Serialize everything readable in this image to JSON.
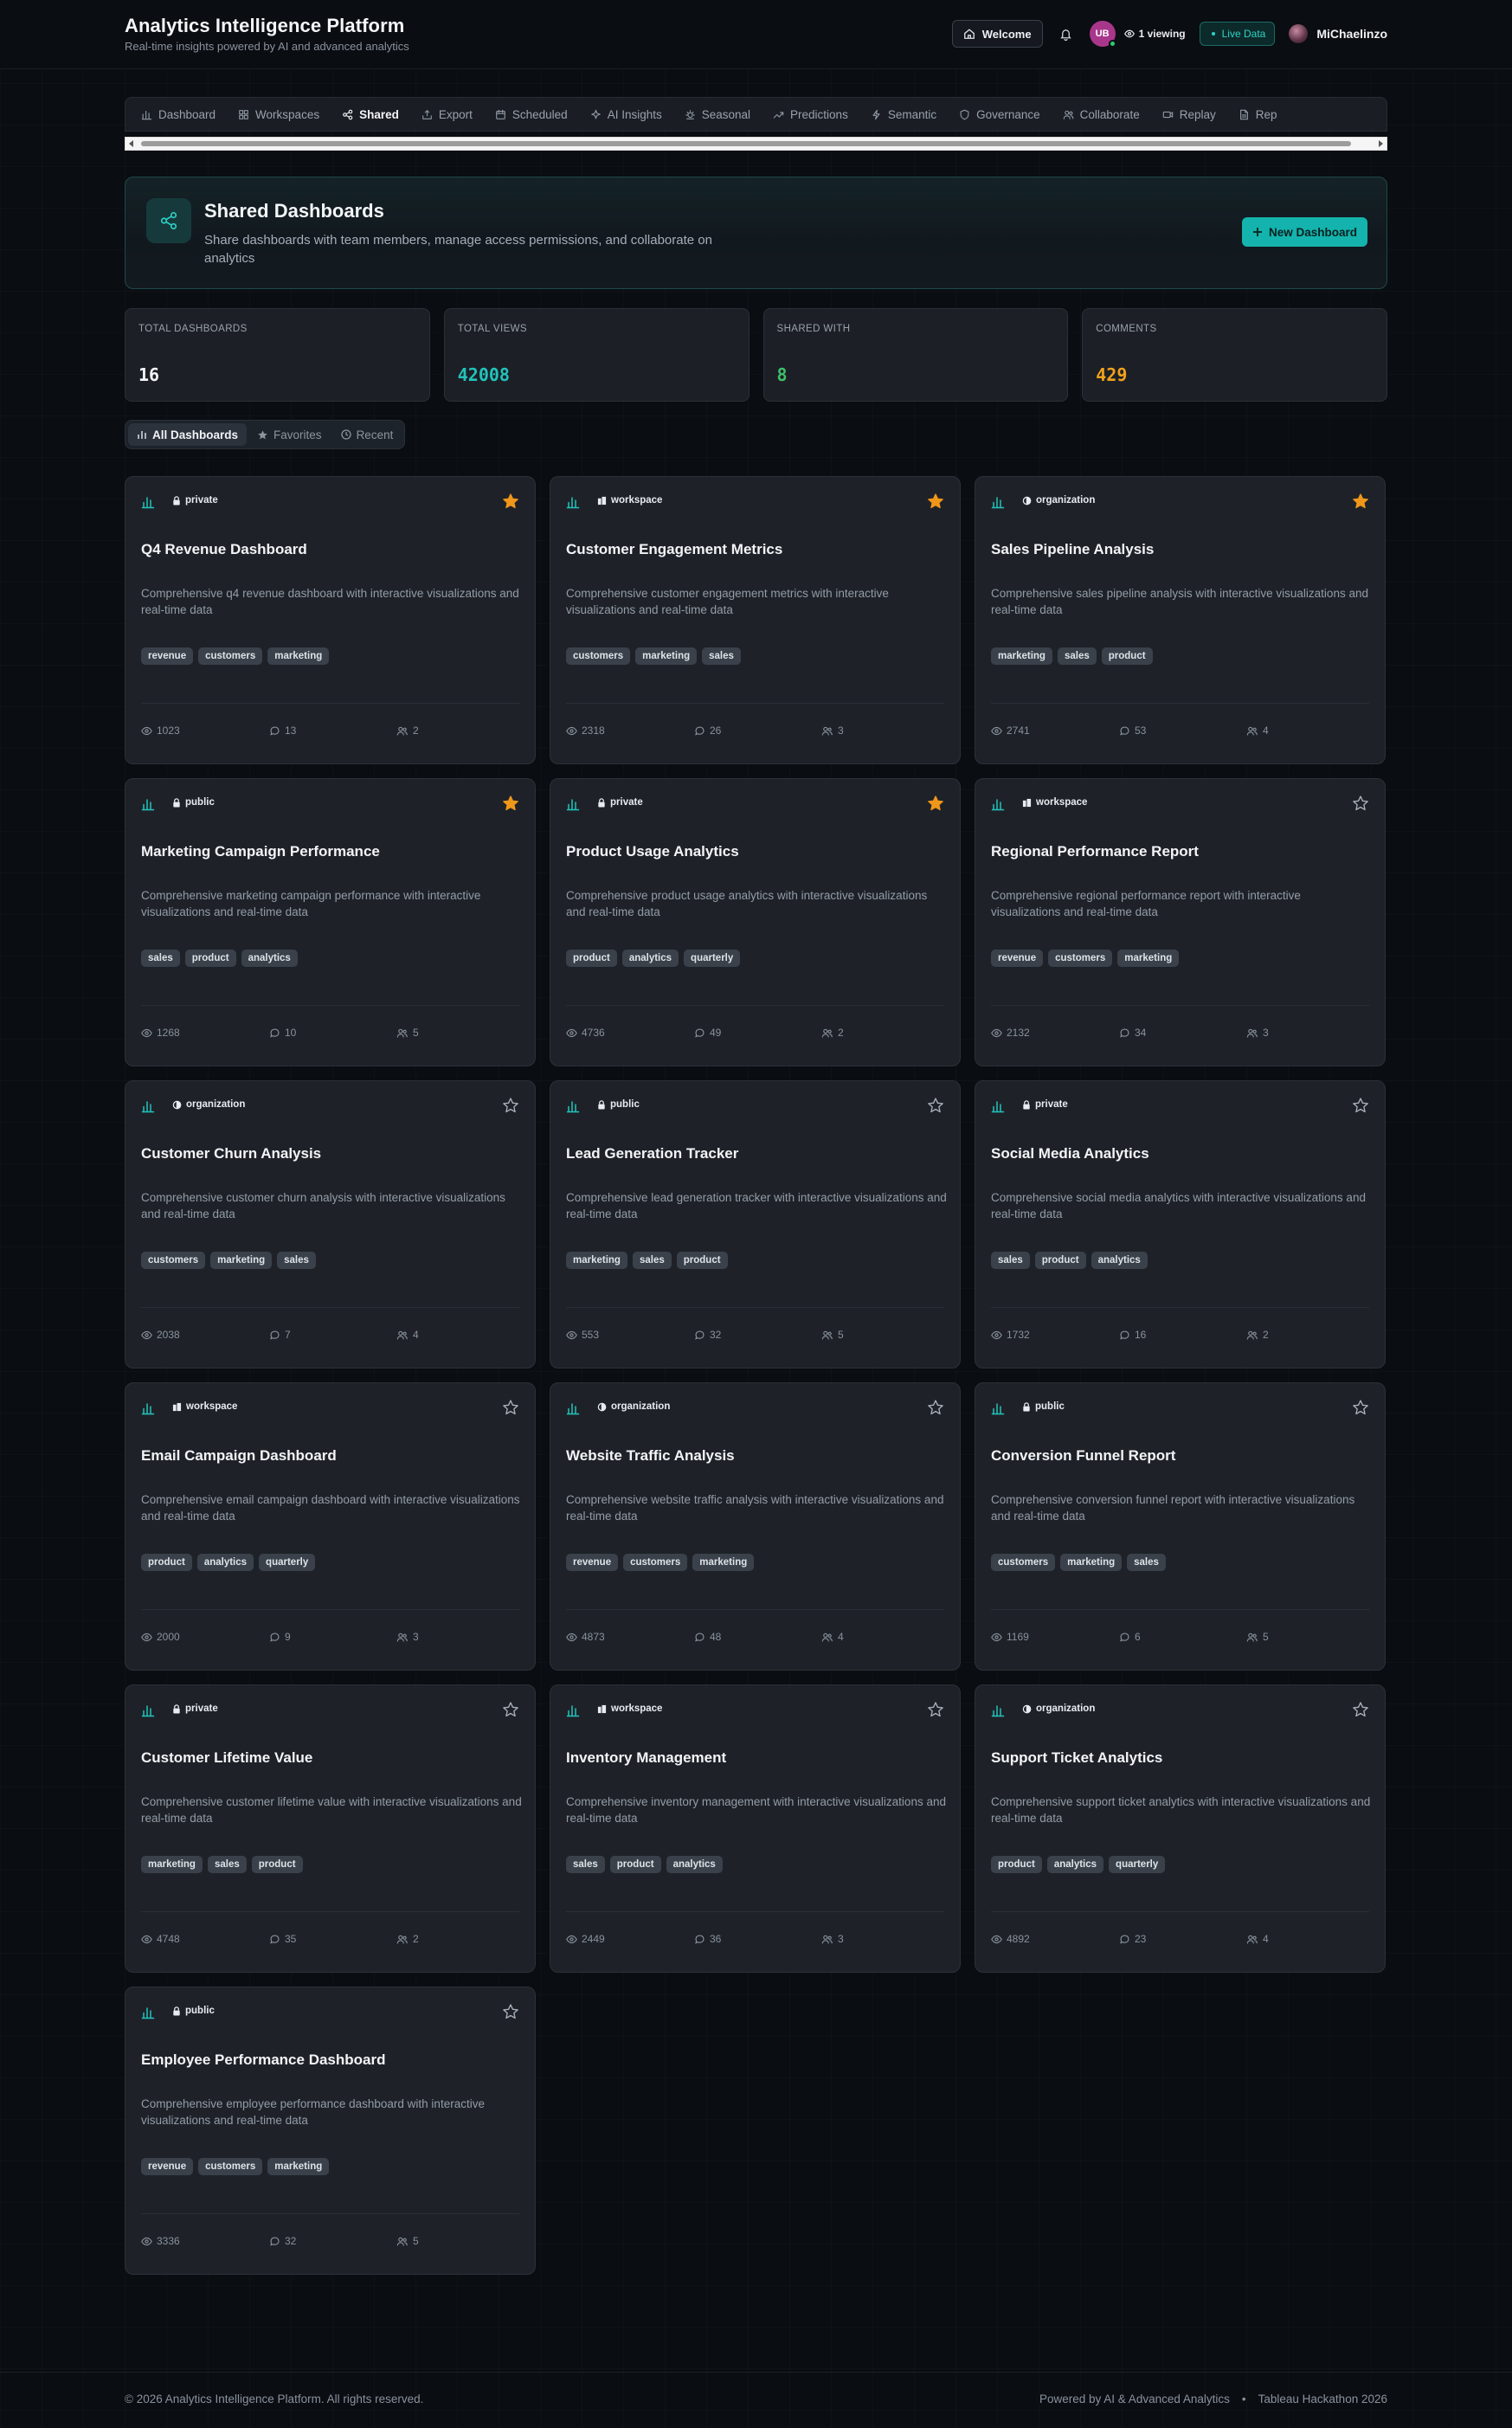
{
  "header": {
    "title": "Analytics Intelligence Platform",
    "subtitle": "Real-time insights powered by AI and advanced analytics",
    "welcome_label": "Welcome",
    "avatar_initials": "UB",
    "viewing": "1 viewing",
    "live_label": "Live Data",
    "username": "MiChaelinzo"
  },
  "nav": {
    "tabs": [
      {
        "label": "Dashboard",
        "icon": "bar-chart-icon",
        "active": false
      },
      {
        "label": "Workspaces",
        "icon": "grid-icon",
        "active": false
      },
      {
        "label": "Shared",
        "icon": "share-icon",
        "active": true
      },
      {
        "label": "Export",
        "icon": "export-icon",
        "active": false
      },
      {
        "label": "Scheduled",
        "icon": "calendar-icon",
        "active": false
      },
      {
        "label": "AI Insights",
        "icon": "sparkle-icon",
        "active": false
      },
      {
        "label": "Seasonal",
        "icon": "seasonal-icon",
        "active": false
      },
      {
        "label": "Predictions",
        "icon": "trend-icon",
        "active": false
      },
      {
        "label": "Semantic",
        "icon": "lightning-icon",
        "active": false
      },
      {
        "label": "Governance",
        "icon": "shield-icon",
        "active": false
      },
      {
        "label": "Collaborate",
        "icon": "users-icon",
        "active": false
      },
      {
        "label": "Replay",
        "icon": "video-icon",
        "active": false
      },
      {
        "label": "Rep",
        "icon": "file-icon",
        "active": false
      }
    ]
  },
  "hero": {
    "title": "Shared Dashboards",
    "description": "Share dashboards with team members, manage access permissions, and collaborate on analytics",
    "new_button": "New Dashboard"
  },
  "stats": [
    {
      "label": "TOTAL DASHBOARDS",
      "value": "16",
      "color": "#f2f4f7"
    },
    {
      "label": "TOTAL VIEWS",
      "value": "42008",
      "color": "#22c3bb"
    },
    {
      "label": "SHARED WITH",
      "value": "8",
      "color": "#3fbf6a"
    },
    {
      "label": "COMMENTS",
      "value": "429",
      "color": "#f0a21a"
    }
  ],
  "filters": {
    "all": "All Dashboards",
    "favorites": "Favorites",
    "recent": "Recent"
  },
  "colors": {
    "accent": "#14b3ad",
    "star_filled": "#f0961a",
    "background": "#0a0d11",
    "card": "#1e2228"
  },
  "dashboards": [
    {
      "title": "Q4 Revenue Dashboard",
      "visibility": "private",
      "favorite": true,
      "description": "Comprehensive q4 revenue dashboard with interactive visualizations and real-time data",
      "tags": [
        "revenue",
        "customers",
        "marketing"
      ],
      "views": "1023",
      "comments": "13",
      "shared": "2"
    },
    {
      "title": "Customer Engagement Metrics",
      "visibility": "workspace",
      "favorite": true,
      "description": "Comprehensive customer engagement metrics with interactive visualizations and real-time data",
      "tags": [
        "customers",
        "marketing",
        "sales"
      ],
      "views": "2318",
      "comments": "26",
      "shared": "3"
    },
    {
      "title": "Sales Pipeline Analysis",
      "visibility": "organization",
      "favorite": true,
      "description": "Comprehensive sales pipeline analysis with interactive visualizations and real-time data",
      "tags": [
        "marketing",
        "sales",
        "product"
      ],
      "views": "2741",
      "comments": "53",
      "shared": "4"
    },
    {
      "title": "Marketing Campaign Performance",
      "visibility": "public",
      "favorite": true,
      "description": "Comprehensive marketing campaign performance with interactive visualizations and real-time data",
      "tags": [
        "sales",
        "product",
        "analytics"
      ],
      "views": "1268",
      "comments": "10",
      "shared": "5"
    },
    {
      "title": "Product Usage Analytics",
      "visibility": "private",
      "favorite": true,
      "description": "Comprehensive product usage analytics with interactive visualizations and real-time data",
      "tags": [
        "product",
        "analytics",
        "quarterly"
      ],
      "views": "4736",
      "comments": "49",
      "shared": "2"
    },
    {
      "title": "Regional Performance Report",
      "visibility": "workspace",
      "favorite": false,
      "description": "Comprehensive regional performance report with interactive visualizations and real-time data",
      "tags": [
        "revenue",
        "customers",
        "marketing"
      ],
      "views": "2132",
      "comments": "34",
      "shared": "3"
    },
    {
      "title": "Customer Churn Analysis",
      "visibility": "organization",
      "favorite": false,
      "description": "Comprehensive customer churn analysis with interactive visualizations and real-time data",
      "tags": [
        "customers",
        "marketing",
        "sales"
      ],
      "views": "2038",
      "comments": "7",
      "shared": "4"
    },
    {
      "title": "Lead Generation Tracker",
      "visibility": "public",
      "favorite": false,
      "description": "Comprehensive lead generation tracker with interactive visualizations and real-time data",
      "tags": [
        "marketing",
        "sales",
        "product"
      ],
      "views": "553",
      "comments": "32",
      "shared": "5"
    },
    {
      "title": "Social Media Analytics",
      "visibility": "private",
      "favorite": false,
      "description": "Comprehensive social media analytics with interactive visualizations and real-time data",
      "tags": [
        "sales",
        "product",
        "analytics"
      ],
      "views": "1732",
      "comments": "16",
      "shared": "2"
    },
    {
      "title": "Email Campaign Dashboard",
      "visibility": "workspace",
      "favorite": false,
      "description": "Comprehensive email campaign dashboard with interactive visualizations and real-time data",
      "tags": [
        "product",
        "analytics",
        "quarterly"
      ],
      "views": "2000",
      "comments": "9",
      "shared": "3"
    },
    {
      "title": "Website Traffic Analysis",
      "visibility": "organization",
      "favorite": false,
      "description": "Comprehensive website traffic analysis with interactive visualizations and real-time data",
      "tags": [
        "revenue",
        "customers",
        "marketing"
      ],
      "views": "4873",
      "comments": "48",
      "shared": "4"
    },
    {
      "title": "Conversion Funnel Report",
      "visibility": "public",
      "favorite": false,
      "description": "Comprehensive conversion funnel report with interactive visualizations and real-time data",
      "tags": [
        "customers",
        "marketing",
        "sales"
      ],
      "views": "1169",
      "comments": "6",
      "shared": "5"
    },
    {
      "title": "Customer Lifetime Value",
      "visibility": "private",
      "favorite": false,
      "description": "Comprehensive customer lifetime value with interactive visualizations and real-time data",
      "tags": [
        "marketing",
        "sales",
        "product"
      ],
      "views": "4748",
      "comments": "35",
      "shared": "2"
    },
    {
      "title": "Inventory Management",
      "visibility": "workspace",
      "favorite": false,
      "description": "Comprehensive inventory management with interactive visualizations and real-time data",
      "tags": [
        "sales",
        "product",
        "analytics"
      ],
      "views": "2449",
      "comments": "36",
      "shared": "3"
    },
    {
      "title": "Support Ticket Analytics",
      "visibility": "organization",
      "favorite": false,
      "description": "Comprehensive support ticket analytics with interactive visualizations and real-time data",
      "tags": [
        "product",
        "analytics",
        "quarterly"
      ],
      "views": "4892",
      "comments": "23",
      "shared": "4"
    },
    {
      "title": "Employee Performance Dashboard",
      "visibility": "public",
      "favorite": false,
      "description": "Comprehensive employee performance dashboard with interactive visualizations and real-time data",
      "tags": [
        "revenue",
        "customers",
        "marketing"
      ],
      "views": "3336",
      "comments": "32",
      "shared": "5"
    }
  ],
  "footer": {
    "copyright": "© 2026 Analytics Intelligence Platform. All rights reserved.",
    "powered": "Powered by AI & Advanced Analytics",
    "separator": "•",
    "event": "Tableau Hackathon 2026"
  }
}
